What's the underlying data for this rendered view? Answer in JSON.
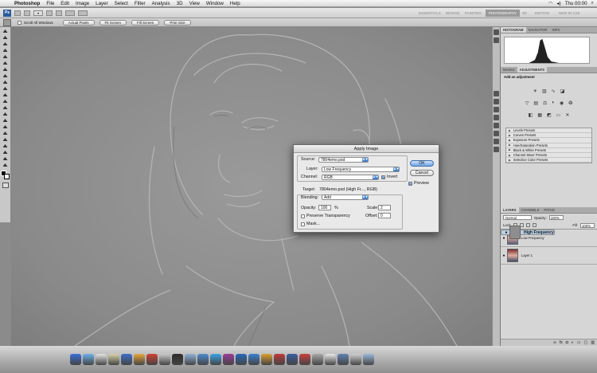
{
  "menubar": {
    "app": "Photoshop",
    "items": [
      "File",
      "Edit",
      "Image",
      "Layer",
      "Select",
      "Filter",
      "Analysis",
      "3D",
      "View",
      "Window",
      "Help"
    ],
    "clock": "Thu 00:00"
  },
  "appbar": {
    "workspaces": [
      "ESSENTIALS",
      "DESIGN",
      "PAINTING",
      "PHOTOGRAPHY",
      "3D",
      "MOTION",
      "NEW IN CS5"
    ],
    "active_workspace": "PHOTOGRAPHY"
  },
  "optionsbar": {
    "scroll_all_label": "Scroll All Windows",
    "buttons": [
      "Actual Pixels",
      "Fit Screen",
      "Fill Screen",
      "Print Size"
    ]
  },
  "panels": {
    "histogram_tabs": [
      "HISTOGRAM",
      "NAVIGATOR",
      "INFO"
    ],
    "adjust_tabs": [
      "MASKS",
      "ADJUSTMENTS"
    ],
    "adjust_hint": "Add an adjustment",
    "presets": [
      "Levels Presets",
      "Curves Presets",
      "Exposure Presets",
      "Hue/Saturation Presets",
      "Black & White Presets",
      "Channel Mixer Presets",
      "Selective Color Presets"
    ],
    "layers_tabs": [
      "LAYERS",
      "CHANNELS",
      "PATHS"
    ],
    "blend_mode": "Normal",
    "opacity_label": "Opacity:",
    "opacity_value": "100%",
    "lock_label": "Lock:",
    "fill_label": "Fill:",
    "fill_value": "100%",
    "layers": [
      {
        "name": "High Frequency",
        "selected": true
      },
      {
        "name": "Low Frequency",
        "selected": false
      },
      {
        "name": "Layer 1",
        "selected": false
      }
    ]
  },
  "dialog": {
    "title": "Apply Image",
    "source_label": "Source:",
    "source_value": "7804emo.psd",
    "layer_label": "Layer:",
    "layer_value": "Low Frequency",
    "channel_label": "Channel:",
    "channel_value": "RGB",
    "invert_label": "Invert",
    "target_label": "Target:",
    "target_value": "7804emo.psd (High Fr..., RGB)",
    "blending_label": "Blending:",
    "blending_value": "Add",
    "opacity_label": "Opacity:",
    "opacity_value": "100",
    "opacity_unit": "%",
    "scale_label": "Scale:",
    "scale_value": "2",
    "offset_label": "Offset:",
    "offset_value": "0",
    "preserve_label": "Preserve Transparency",
    "mask_label": "Mask...",
    "ok_label": "OK",
    "cancel_label": "Cancel",
    "preview_label": "Preview"
  },
  "dock": {
    "icon_colors": [
      "#3a6fd8",
      "#6bb0ee",
      "#e4e4e4",
      "#d9d2a8",
      "#3d70c8",
      "#e8a63a",
      "#d04030",
      "#c8c8c8",
      "#2c2c2c",
      "#8fb0d8",
      "#4d8cd0",
      "#36a3e4",
      "#9b3a9c",
      "#2868b8",
      "#3a7fd0",
      "#d8a030",
      "#c03a3a",
      "#3a5fa0",
      "#c84040",
      "#a8a8a8",
      "#e9e9e9",
      "#6080b0",
      "#d0d0d0",
      "#9ab8dc"
    ]
  }
}
